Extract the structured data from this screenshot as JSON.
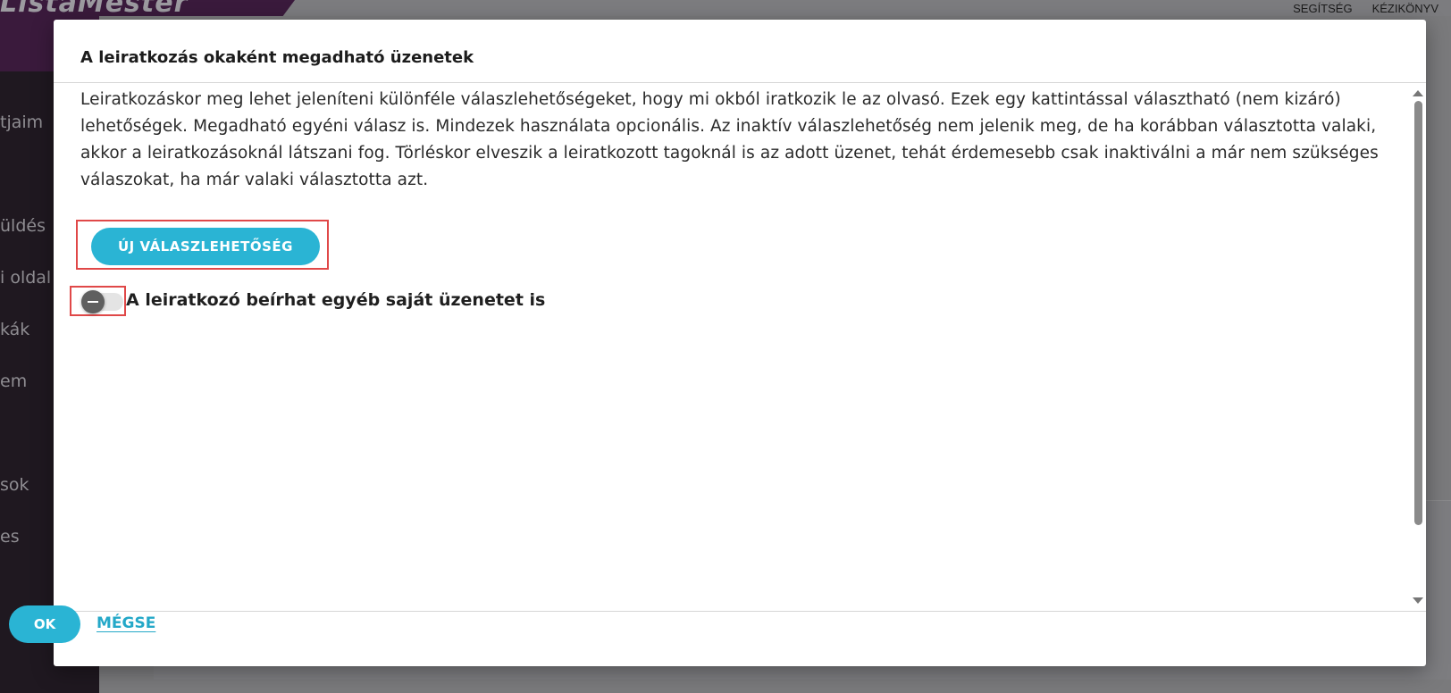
{
  "background": {
    "logo_text": "ListaMester",
    "top_nav": [
      "SEGÍTSÉG",
      "KÉZIKÖNYV"
    ],
    "sidebar_fragments": [
      "tjaim",
      "üldés",
      "i oldal",
      "kák",
      "em",
      "sok",
      "es"
    ]
  },
  "modal": {
    "title": "A leiratkozás okaként megadható üzenetek",
    "description": "Leiratkozáskor meg lehet jeleníteni különféle válaszlehetőségeket, hogy mi okból iratkozik le az olvasó. Ezek egy kattintással választható (nem kizáró) lehetőségek. Megadható egyéni válasz is. Mindezek használata opcionális. Az inaktív válaszlehetőség nem jelenik meg, de ha korábban választotta valaki, akkor a leiratkozásoknál látszani fog. Törléskor elveszik a leiratkozott tagoknál is az adott üzenet, tehát érdemesebb csak inaktiválni a már nem szükséges válaszokat, ha már valaki választotta azt.",
    "new_option_button": "ÚJ VÁLASZLEHETŐSÉG",
    "custom_message_toggle": {
      "label": "A leiratkozó beírhat egyéb saját üzenetet is",
      "state": "off"
    },
    "ok_button": "OK",
    "cancel_link": "MÉGSE"
  },
  "colors": {
    "accent": "#2ab4d4",
    "highlight": "#e04848",
    "sidebar": "#1f1820"
  }
}
